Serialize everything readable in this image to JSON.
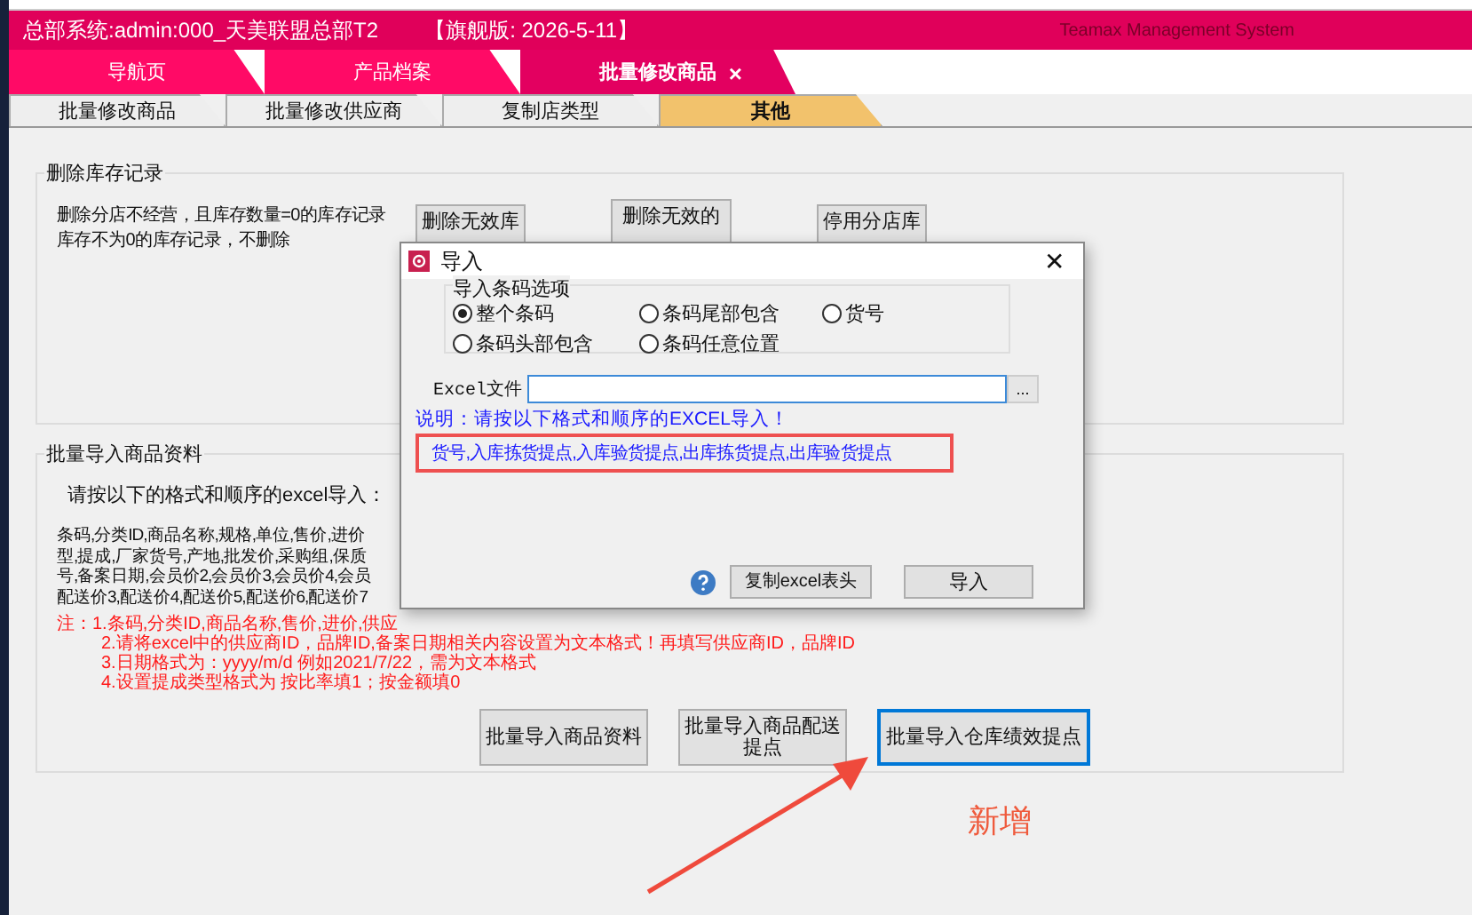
{
  "header": {
    "title": "总部系统:admin:000_天美联盟总部T2",
    "edition": "【旗舰版: 2026-5-11】",
    "brand": "Teamax Management System"
  },
  "tabs": [
    {
      "label": "导航页",
      "selected": false
    },
    {
      "label": "产品档案",
      "selected": false
    },
    {
      "label": "批量修改商品",
      "selected": true,
      "close": "×"
    }
  ],
  "subtabs": [
    {
      "label": "批量修改商品",
      "selected": false
    },
    {
      "label": "批量修改供应商",
      "selected": false
    },
    {
      "label": "复制店类型",
      "selected": false
    },
    {
      "label": "其他",
      "selected": true
    }
  ],
  "delete_stock": {
    "title": "删除库存记录",
    "lines": [
      "删除分店不经营，且库存数量=0的库存记录",
      "库存不为0的库存记录，不删除"
    ],
    "buttons": [
      "删除无效库",
      "删除无效的",
      "停用分店库"
    ]
  },
  "batch_import": {
    "title": "批量导入商品资料",
    "instruction": "请按以下的格式和顺序的excel导入：",
    "field_lines": [
      "条码,分类ID,商品名称,规格,单位,售价,进价",
      "型,提成,厂家货号,产地,批发价,采购组,保质",
      "号,备案日期,会员价2,会员价3,会员价4,会员",
      "配送价3,配送价4,配送价5,配送价6,配送价7"
    ],
    "notes": [
      "注：1.条码,分类ID,商品名称,售价,进价,供应",
      "2.请将excel中的供应商ID，品牌ID,备案日期相关内容设置为文本格式！再填写供应商ID，品牌ID",
      "3.日期格式为：yyyy/m/d 例如2021/7/22，需为文本格式",
      "4.设置提成类型格式为 按比率填1；按金额填0"
    ],
    "buttons": [
      {
        "label": "批量导入商品资料",
        "focused": false
      },
      {
        "label": "批量导入商品配送提点",
        "focused": false
      },
      {
        "label": "批量导入仓库绩效提点",
        "focused": true
      }
    ]
  },
  "dialog": {
    "title": "导入",
    "close": "✕",
    "group_title": "导入条码选项",
    "options": [
      {
        "label": "整个条码",
        "selected": true
      },
      {
        "label": "条码尾部包含",
        "selected": false
      },
      {
        "label": "货号",
        "selected": false
      },
      {
        "label": "条码头部包含",
        "selected": false
      },
      {
        "label": "条码任意位置",
        "selected": false
      }
    ],
    "file_label": "Excel文件",
    "browse": "...",
    "note": "说明：请按以下格式和顺序的EXCEL导入！",
    "columns": "货号,入库拣货提点,入库验货提点,出库拣货提点,出库验货提点",
    "copy_button": "复制excel表头",
    "import_button": "导入"
  },
  "annotation": {
    "text": "新增"
  }
}
